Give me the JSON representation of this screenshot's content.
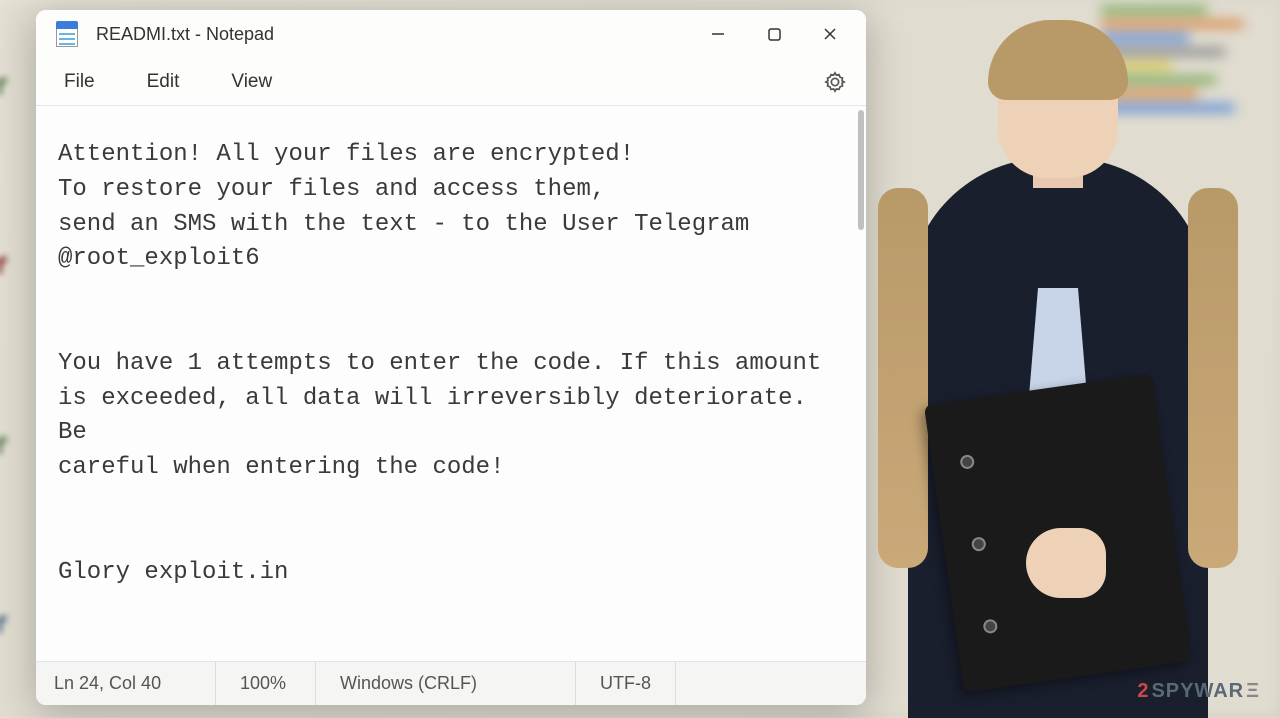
{
  "window": {
    "title": "READMI.txt - Notepad"
  },
  "menu": {
    "file": "File",
    "edit": "Edit",
    "view": "View"
  },
  "content": {
    "text": "Attention! All your files are encrypted!\nTo restore your files and access them,\nsend an SMS with the text - to the User Telegram\n@root_exploit6\n\n\nYou have 1 attempts to enter the code. If this amount is exceeded, all data will irreversibly deteriorate. Be\ncareful when entering the code!\n\n\nGlory exploit.in"
  },
  "statusbar": {
    "position": "Ln 24, Col 40",
    "zoom": "100%",
    "eol": "Windows (CRLF)",
    "encoding": "UTF-8"
  },
  "watermark": {
    "num": "2",
    "text": "SPYWAR",
    "arrow": "Ξ"
  },
  "bg": {
    "if1": "if",
    "if2": "if",
    "if3": "if",
    "if4": "if"
  }
}
